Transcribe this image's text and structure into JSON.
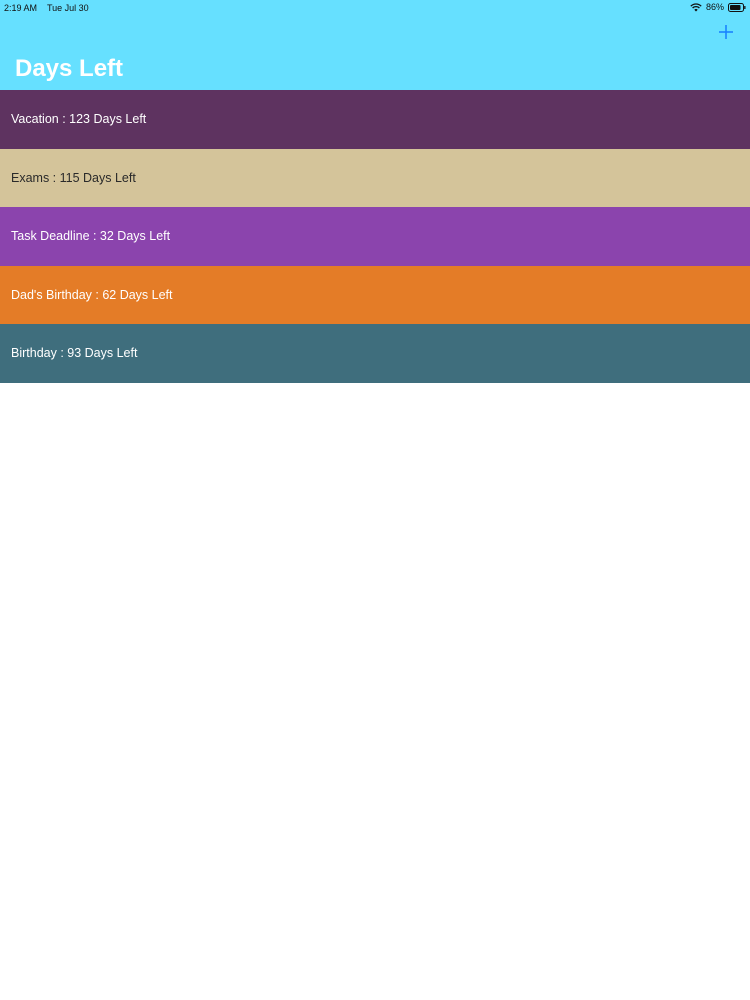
{
  "status_bar": {
    "time": "2:19 AM",
    "date": "Tue Jul 30",
    "battery": "86%"
  },
  "nav": {
    "title": "Days Left",
    "add_icon": "plus-icon"
  },
  "events": [
    {
      "name": "Vacation",
      "days": 123,
      "label": "Vacation : 123 Days Left",
      "color": "#5e3360",
      "text_color": "#ffffff"
    },
    {
      "name": "Exams",
      "days": 115,
      "label": "Exams : 115 Days Left",
      "color": "#d4c49a",
      "text_color": "#2a2a2a"
    },
    {
      "name": "Task Deadline",
      "days": 32,
      "label": "Task Deadline : 32 Days Left",
      "color": "#8b44ad",
      "text_color": "#ffffff"
    },
    {
      "name": "Dad's Birthday",
      "days": 62,
      "label": "Dad's Birthday : 62 Days Left",
      "color": "#e47c27",
      "text_color": "#ffffff"
    },
    {
      "name": "Birthday",
      "days": 93,
      "label": "Birthday : 93 Days Left",
      "color": "#3f6e7d",
      "text_color": "#ffffff"
    }
  ],
  "colors": {
    "header_bg": "#66e0ff",
    "accent": "#1a84ff",
    "background": "#ffffff"
  }
}
